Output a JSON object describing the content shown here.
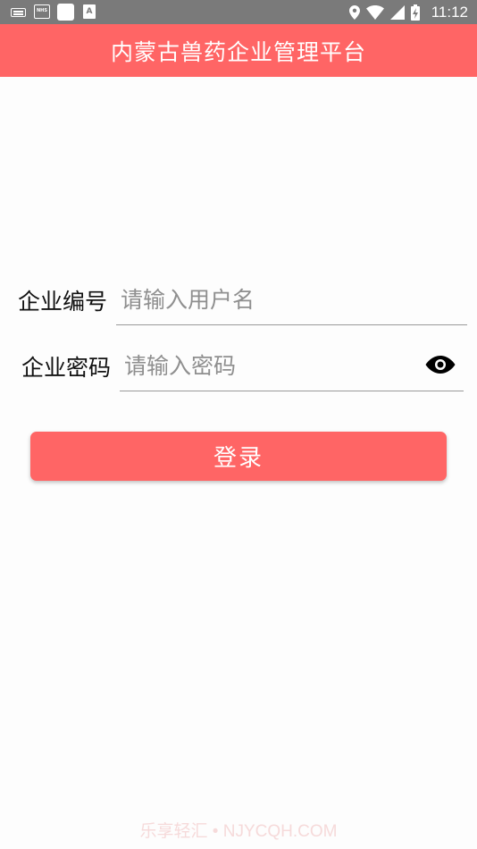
{
  "status_bar": {
    "time": "11:12",
    "left_icons": [
      "keyboard-icon",
      "news-icon",
      "blank-app-icon",
      "a-icon"
    ],
    "right_icons": [
      "location-icon",
      "wifi-icon",
      "cell-signal-icon",
      "battery-charging-icon"
    ]
  },
  "app_bar": {
    "title": "内蒙古兽药企业管理平台",
    "color": "#ff6565"
  },
  "form": {
    "username_label": "企业编号",
    "username_placeholder": "请输入用户名",
    "password_label": "企业密码",
    "password_placeholder": "请输入密码",
    "show_password_icon": "eye-icon"
  },
  "login_button": {
    "label": "登录",
    "color": "#ff6565"
  },
  "watermark": "乐享轻汇 • NJYCQH.COM"
}
